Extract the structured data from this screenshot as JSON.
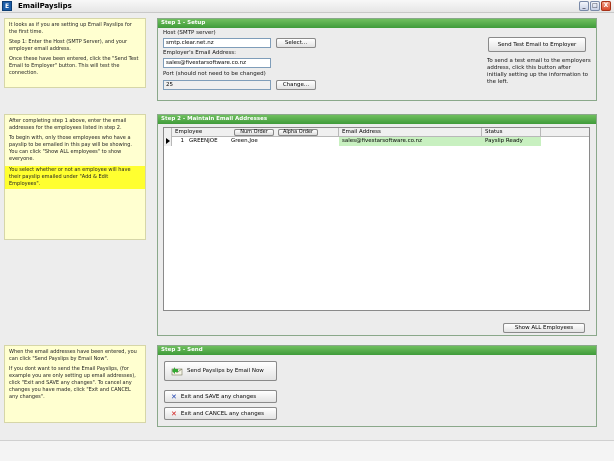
{
  "window": {
    "title": "EmailPayslips",
    "icon_text": "E",
    "controls": [
      "_",
      "□",
      "X"
    ]
  },
  "notes": {
    "setup": [
      "It looks as if you are setting up Email Payslips for the first time.",
      "Step 1: Enter the Host (SMTP Server), and your employer email address.",
      "Once these have been entered, click the \"Send Test Email to Employer\" button. This will test the connection."
    ],
    "maintain": [
      "After completing step 1 above, enter the email addresses for the employees listed in step 2.",
      "To begin with, only those employees who have a payslip to be emailed in this pay will be showing. You can click \"Show ALL employees\" to show everyone.",
      "You select whether or not an employee will have their payslip emailed under \"Add & Edit Employees\"."
    ],
    "send": [
      "When the email addresses have been entered, you can click \"Send Payslips by Email Now\".",
      "If you dont want to send the Email Payslips, (for example you are only setting up email addresses), click \"Exit and SAVE any changes\". To cancel any changes you have made, click \"Exit and CANCEL any changes\"."
    ]
  },
  "step1": {
    "header": "Step 1 - Setup",
    "host_label": "Host (SMTP server)",
    "host_value": "smtp.clear.net.nz",
    "select_button": "Select...",
    "employer_email_label": "Employer's Email Address:",
    "employer_email_value": "sales@fivestarsoftware.co.nz",
    "port_label": "Port (should not need to be changed)",
    "port_value": "25",
    "change_button": "Change...",
    "test_button": "Send Test Email to Employer",
    "test_help": "To send a test email to the employers address, click this button after initially setting up the information to the left."
  },
  "step2": {
    "header": "Step 2 - Maintain Email Addresses",
    "columns": {
      "employee": "Employee",
      "num_order": "Num Order",
      "alpha_order": "Alpha Order",
      "email": "Email Address",
      "status": "Status"
    },
    "rows": [
      {
        "num": "1",
        "code": "GREENJOE",
        "name": "Green,Joe",
        "email": "sales@fivestarsoftware.co.nz",
        "status": "Payslip Ready"
      }
    ],
    "show_all_button": "Show ALL Employees"
  },
  "step3": {
    "header": "Step 3 - Send",
    "send_button": "Send Payslips by Email Now",
    "save_button": "Exit and SAVE any changes",
    "cancel_button": "Exit and CANCEL any changes"
  },
  "colors": {
    "panel_header": "#4aa743",
    "note_background": "#ffffd0",
    "note_highlight": "#ffff30",
    "ready_row": "#c8f0c0"
  }
}
